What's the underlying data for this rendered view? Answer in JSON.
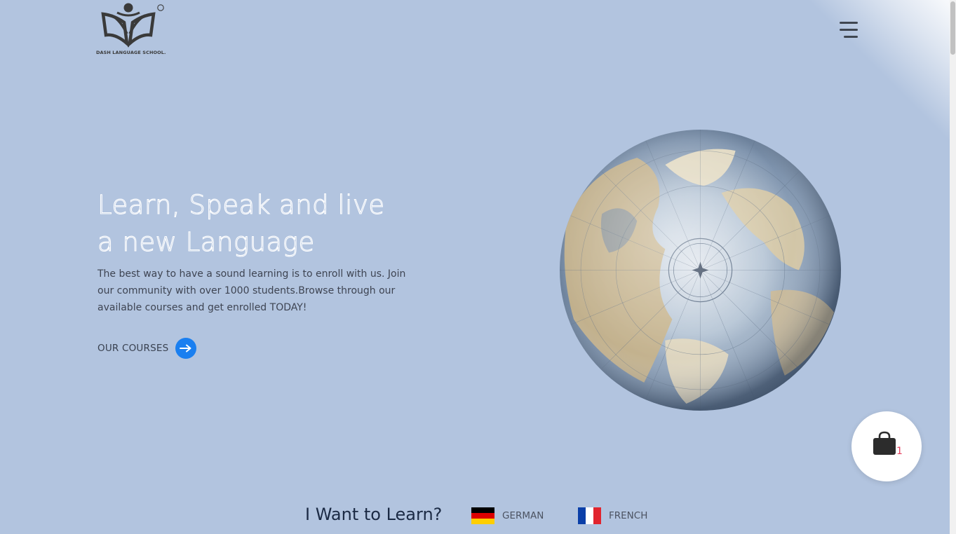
{
  "logo": {
    "brand_text": "DASH LANGUAGE SCHOOL.",
    "registered_mark": "®"
  },
  "header": {
    "menu_icon": "hamburger-menu-icon"
  },
  "hero": {
    "title_line1": "Learn, Speak and live",
    "title_line2": "a new Language",
    "description": "The best way to have a sound learning is to enroll with us. Join our community with over 1000 students.Browse through our available courses and get enrolled TODAY!",
    "cta_label": "OUR COURSES",
    "cta_icon": "arrow-right-icon",
    "image": "antique-globe-image"
  },
  "cart": {
    "icon": "shopping-bag-icon",
    "count": "1"
  },
  "learn": {
    "heading": "I Want to Learn?",
    "languages": [
      {
        "label": "GERMAN",
        "flag": "germany-flag-icon"
      },
      {
        "label": "FRENCH",
        "flag": "france-flag-icon"
      }
    ]
  },
  "colors": {
    "background": "#b2c4df",
    "accent": "#1a7ff0",
    "cart_badge": "#e4405e"
  }
}
